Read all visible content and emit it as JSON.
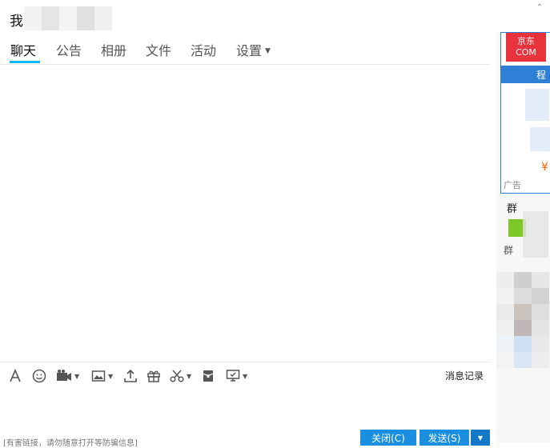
{
  "header": {
    "group_name": "我"
  },
  "tabs": [
    {
      "label": "聊天",
      "active": true
    },
    {
      "label": "公告"
    },
    {
      "label": "相册"
    },
    {
      "label": "文件"
    },
    {
      "label": "活动"
    },
    {
      "label": "设置"
    }
  ],
  "toolbar": {
    "history_label": "消息记录",
    "icons": [
      "font-icon",
      "emoji-icon",
      "video-icon",
      "image-icon",
      "upload-icon",
      "gift-icon",
      "scissors-icon",
      "red-packet-icon",
      "screen-share-icon"
    ]
  },
  "footer": {
    "hint": "[有害链接，请勿随意打开等防骗信息]",
    "close_label": "关闭(C)",
    "send_label": "发送(S)"
  },
  "sidebar": {
    "ad_logo": "京东\nCOM",
    "ad_band_text": "程",
    "ad_price": "¥",
    "ad_label": "广告",
    "group_card_title": "群",
    "group_card_sub": "群"
  },
  "colors": {
    "accent": "#12b7f5",
    "button": "#1a8fe0",
    "ad_border": "#2f7fd6"
  }
}
